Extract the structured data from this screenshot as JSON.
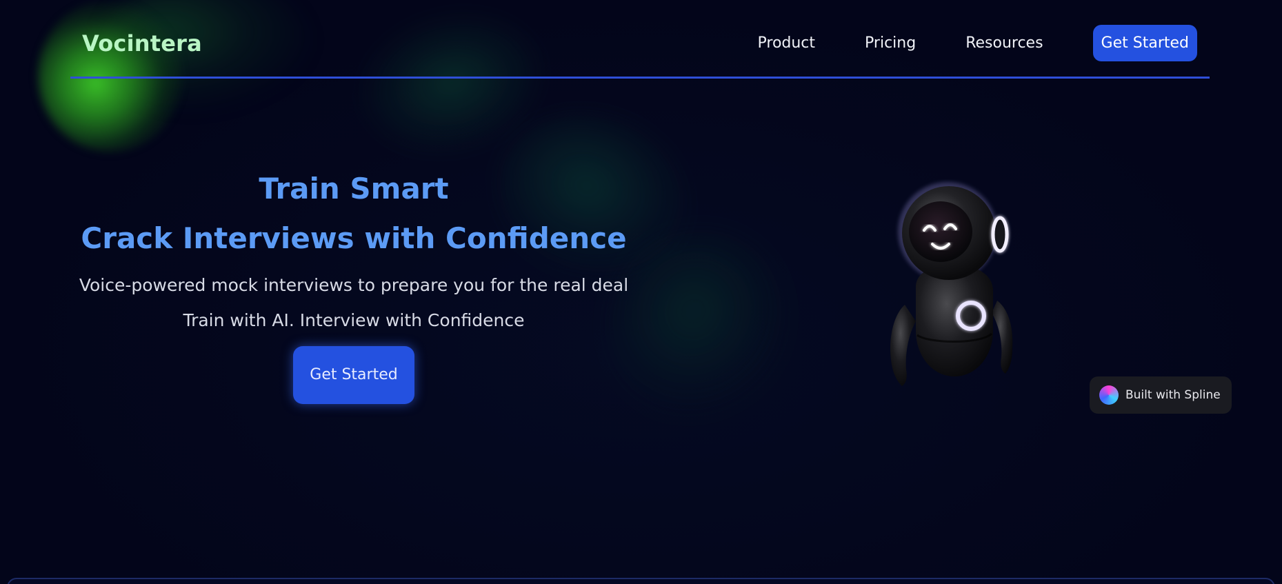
{
  "header": {
    "logo": "Vocintera",
    "nav": {
      "product": "Product",
      "pricing": "Pricing",
      "resources": "Resources",
      "cta": "Get Started"
    }
  },
  "hero": {
    "title_line1": "Train Smart",
    "title_line2": "Crack Interviews with Confidence",
    "subtitle": "Voice-powered mock interviews to prepare you for the real deal",
    "tagline": "Train with AI. Interview with Confidence",
    "cta": "Get Started"
  },
  "badge": {
    "text": "Built with Spline"
  },
  "colors": {
    "background": "#03051a",
    "accent": "#2451e0",
    "hero_title": "#5c9bf5",
    "logo": "#b9f5c4"
  },
  "icons": {
    "robot": "robot-illustration",
    "spline": "spline-logo-icon"
  }
}
